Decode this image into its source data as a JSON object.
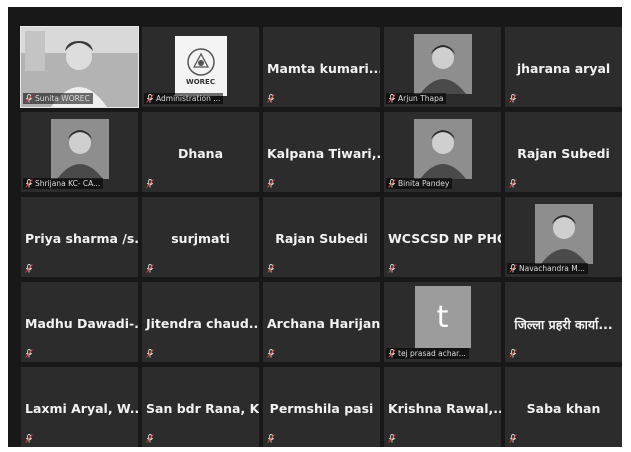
{
  "participants": [
    {
      "name": "",
      "label": "Sunita WOREC",
      "kind": "video-wide"
    },
    {
      "name": "",
      "label": "Administration ...",
      "kind": "logo",
      "logo_text": "WOREC"
    },
    {
      "name": "Mamta kumari...",
      "label": "",
      "kind": "name"
    },
    {
      "name": "",
      "label": "Arjun Thapa",
      "kind": "photo"
    },
    {
      "name": "jharana aryal",
      "label": "",
      "kind": "name"
    },
    {
      "name": "",
      "label": "Shrijana KC- CA...",
      "kind": "photo"
    },
    {
      "name": "Dhana",
      "label": "",
      "kind": "name"
    },
    {
      "name": "Kalpana Tiwari,...",
      "label": "",
      "kind": "name"
    },
    {
      "name": "",
      "label": "Binita Pandey",
      "kind": "photo"
    },
    {
      "name": "Rajan Subedi",
      "label": "",
      "kind": "name"
    },
    {
      "name": "Priya sharma /s...",
      "label": "",
      "kind": "name"
    },
    {
      "name": "surjmati",
      "label": "",
      "kind": "name"
    },
    {
      "name": "Rajan Subedi",
      "label": "",
      "kind": "name"
    },
    {
      "name": "WCSCSD NP PHQ",
      "label": "",
      "kind": "name"
    },
    {
      "name": "",
      "label": "Navachandra M...",
      "kind": "photo"
    },
    {
      "name": "Madhu Dawadi-...",
      "label": "",
      "kind": "name"
    },
    {
      "name": "Jitendra chaud...",
      "label": "",
      "kind": "name"
    },
    {
      "name": "Archana Harijan",
      "label": "",
      "kind": "name"
    },
    {
      "name": "",
      "label": "tej prasad achar...",
      "kind": "letter",
      "initial": "t"
    },
    {
      "name": "जिल्ला प्रहरी कार्या...",
      "label": "",
      "kind": "name"
    },
    {
      "name": "Laxmi Aryal, W...",
      "label": "",
      "kind": "name"
    },
    {
      "name": "San bdr Rana, K...",
      "label": "",
      "kind": "name"
    },
    {
      "name": "Permshila pasi",
      "label": "",
      "kind": "name"
    },
    {
      "name": "Krishna Rawal,...",
      "label": "",
      "kind": "name"
    },
    {
      "name": "Saba khan",
      "label": "",
      "kind": "name"
    }
  ]
}
